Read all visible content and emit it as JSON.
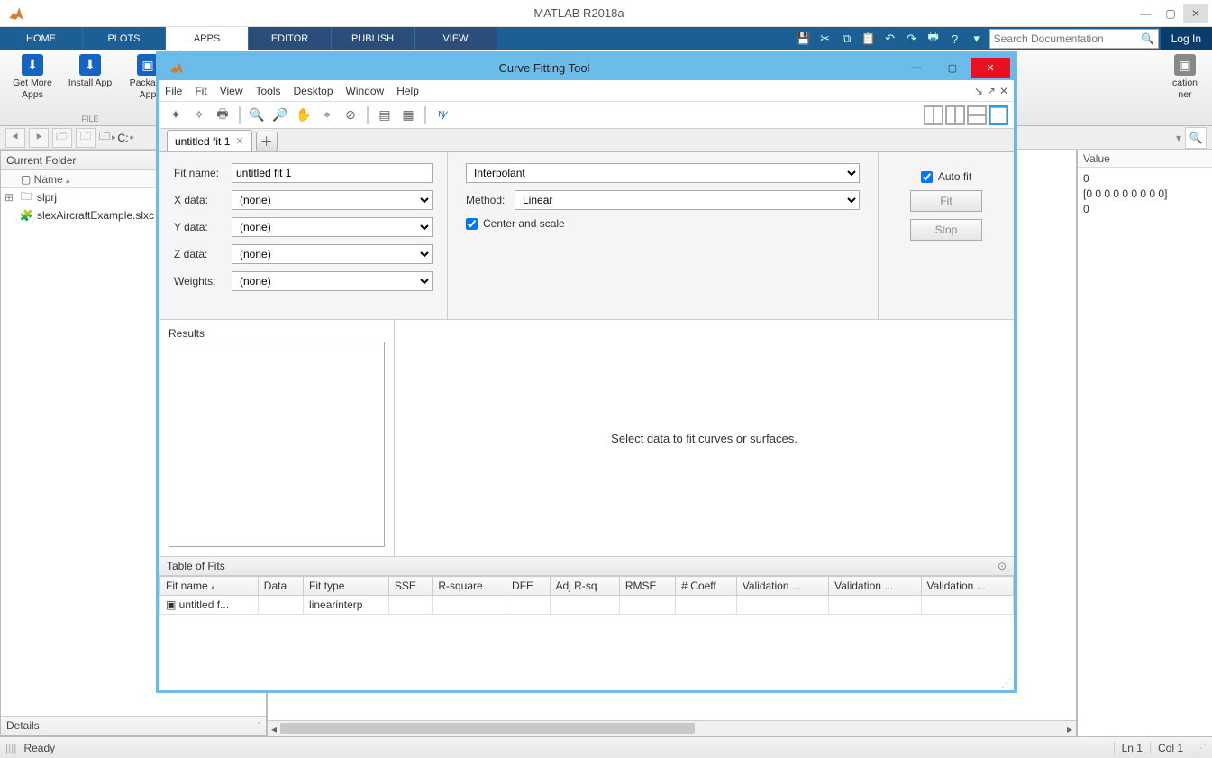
{
  "window": {
    "title": "MATLAB R2018a",
    "search_placeholder": "Search Documentation",
    "login": "Log In"
  },
  "tabs": {
    "home": "HOME",
    "plots": "PLOTS",
    "apps": "APPS",
    "editor": "EDITOR",
    "publish": "PUBLISH",
    "view": "VIEW"
  },
  "apps_group": {
    "get_more": "Get More Apps",
    "install": "Install App",
    "package": "Package App",
    "label": "FILE",
    "designer_fragment_top": "cation",
    "designer_fragment_bot": "ner"
  },
  "addressbar": {
    "drive": "C:",
    "sep": "▸"
  },
  "current_folder": {
    "title": "Current Folder",
    "col_name": "Name",
    "items": [
      {
        "name": "slprj",
        "type": "folder",
        "expandable": true
      },
      {
        "name": "slexAircraftExample.slxc",
        "type": "file",
        "expandable": false
      }
    ],
    "details": "Details"
  },
  "workspace": {
    "col_value": "Value",
    "rows": [
      "0",
      "[0 0 0 0 0 0 0 0 0]",
      "0"
    ]
  },
  "status": {
    "ready": "Ready",
    "ln": "Ln  1",
    "col": "Col  1"
  },
  "cftool": {
    "title": "Curve Fitting Tool",
    "menus": [
      "File",
      "Fit",
      "View",
      "Tools",
      "Desktop",
      "Window",
      "Help"
    ],
    "tab_label": "untitled fit 1",
    "form": {
      "fit_name_label": "Fit name:",
      "fit_name_value": "untitled fit 1",
      "x_label": "X data:",
      "x_value": "(none)",
      "y_label": "Y data:",
      "y_value": "(none)",
      "z_label": "Z data:",
      "z_value": "(none)",
      "w_label": "Weights:",
      "w_value": "(none)"
    },
    "model": {
      "type": "Interpolant",
      "method_label": "Method:",
      "method_value": "Linear",
      "center_scale": "Center and scale"
    },
    "controls": {
      "auto_fit": "Auto fit",
      "fit": "Fit",
      "stop": "Stop"
    },
    "results_label": "Results",
    "plot_placeholder": "Select data to fit curves or surfaces.",
    "table_of_fits": {
      "title": "Table of Fits",
      "headers": [
        "Fit name",
        "Data",
        "Fit type",
        "SSE",
        "R-square",
        "DFE",
        "Adj R-sq",
        "RMSE",
        "# Coeff",
        "Validation ...",
        "Validation ...",
        "Validation ..."
      ],
      "row": {
        "fit_name": "untitled f...",
        "fit_type": "linearinterp"
      }
    }
  }
}
